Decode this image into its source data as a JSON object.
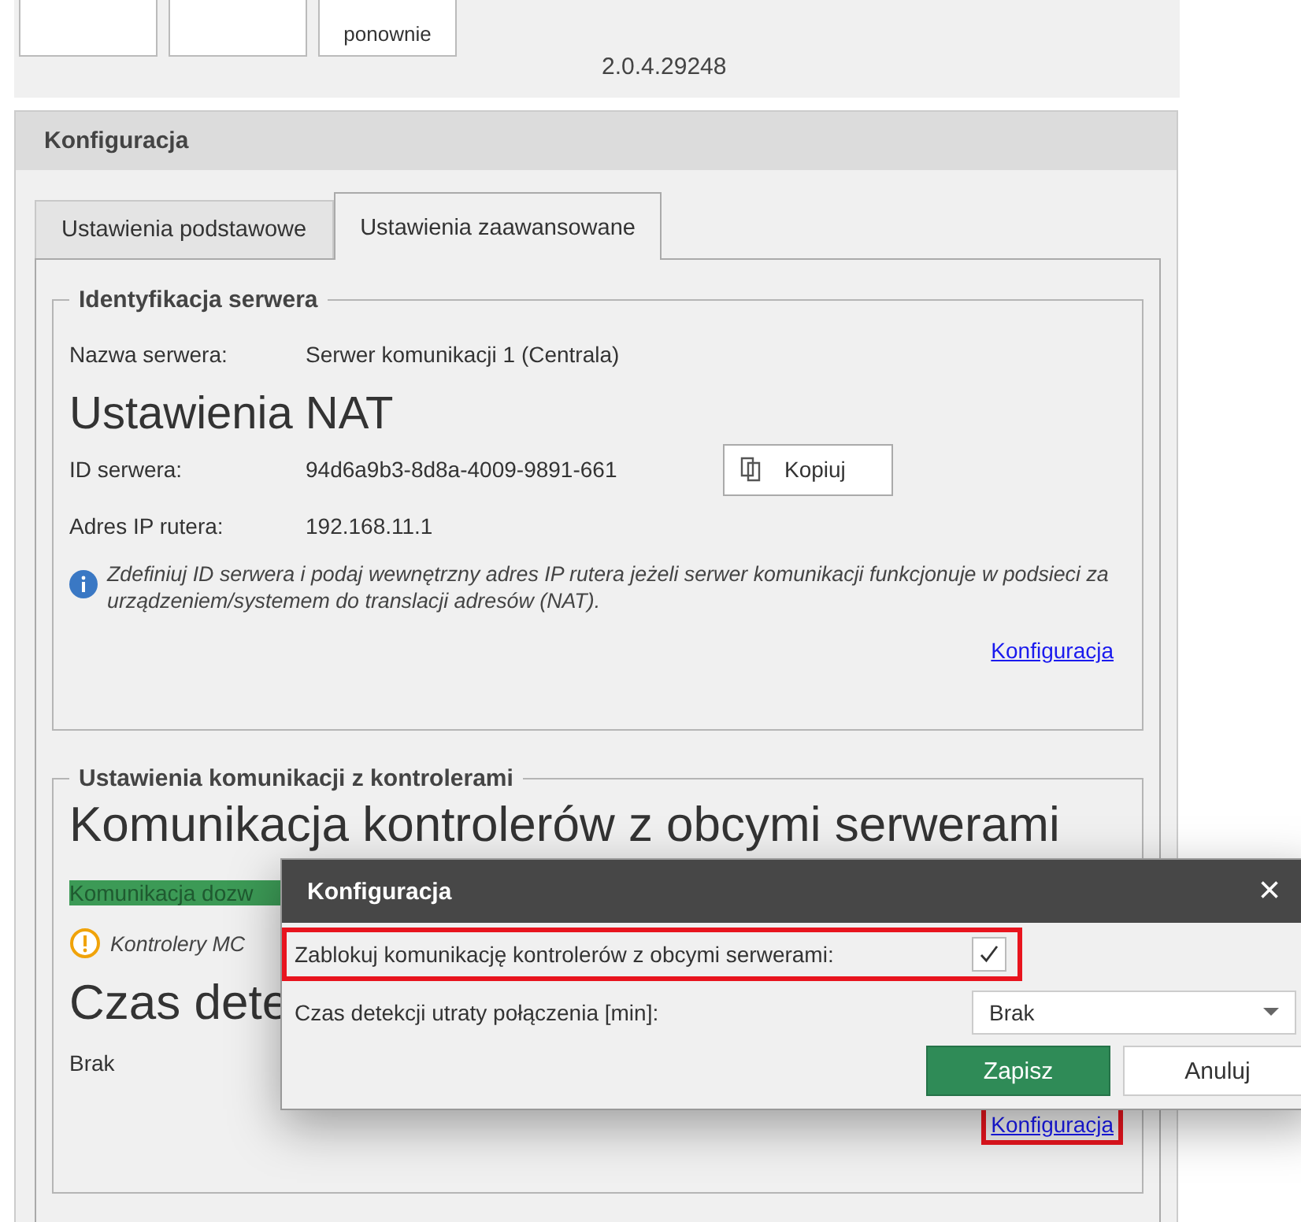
{
  "toolbar": {
    "buttons": [
      {
        "label": "ponownie"
      }
    ],
    "version": "2.0.4.29248"
  },
  "panel": {
    "title": "Konfiguracja",
    "tabs": [
      {
        "label": "Ustawienia podstawowe",
        "selected": false
      },
      {
        "label": "Ustawienia zaawansowane",
        "selected": true
      }
    ],
    "server_group": {
      "title": "Identyfikacja serwera",
      "fields": [
        {
          "label": "Nazwa serwera:",
          "value": "Serwer komunikacji 1 (Centrala)"
        }
      ],
      "nat_heading": "Ustawienia NAT",
      "id_label": "ID serwera:",
      "id_value": "94d6a9b3-8d8a-4009-9891-661",
      "copy_button": "Kopiuj",
      "ip_label": "Adres IP rutera:",
      "ip_value": "192.168.11.1",
      "info": "Zdefiniuj ID serwera i podaj wewnętrzny adres IP rutera jeżeli serwer komunikacji funkcjonuje w podsieci za urządzeniem/systemem do translacji adresów (NAT).",
      "link": {
        "label": "Konfiguracja",
        "highlighted": false
      }
    },
    "controllers_group": {
      "title": "Ustawienia komunikacji z kontrolerami",
      "heading": "Komunikacja kontrolerów z obcymi serwerami",
      "status": "Komunikacja dozw",
      "warning": "Kontrolery MC",
      "timeout_heading": "Czas dete",
      "timeout_value": "Brak",
      "link": {
        "label": "Konfiguracja",
        "highlighted": true
      }
    }
  },
  "dialog": {
    "title": "Konfiguracja",
    "close": "×",
    "block_label": "Zablokuj komunikację kontrolerów z obcymi serwerami:",
    "block_checked": true,
    "block_highlighted": true,
    "timeout_label": "Czas detekcji utraty połączenia [min]:",
    "timeout_value": "Brak",
    "save": "Zapisz",
    "cancel": "Anuluj"
  }
}
